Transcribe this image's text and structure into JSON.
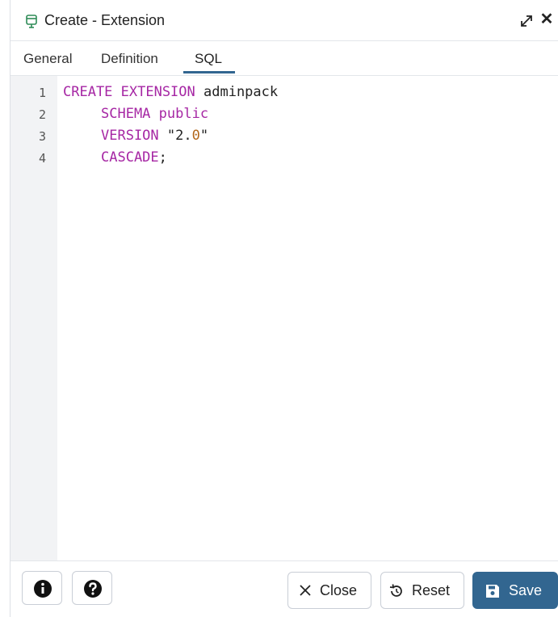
{
  "dialog": {
    "title": "Create - Extension"
  },
  "tabs": [
    {
      "label": "General"
    },
    {
      "label": "Definition"
    },
    {
      "label": "SQL"
    }
  ],
  "active_tab": "SQL",
  "editor": {
    "line_numbers": [
      "1",
      "2",
      "3",
      "4"
    ],
    "lines": [
      {
        "kw": "CREATE EXTENSION",
        "rest": " adminpack"
      },
      {
        "kw": "SCHEMA public",
        "rest": ""
      },
      {
        "kw": "VERSION",
        "str_open": " \"2.",
        "num": "0",
        "str_close": "\""
      },
      {
        "kw": "CASCADE",
        "rest": ";"
      }
    ]
  },
  "footer": {
    "info_icon": "info-icon",
    "help_icon": "help-icon",
    "close_label": "Close",
    "reset_label": "Reset",
    "save_label": "Save"
  },
  "colors": {
    "accent": "#326690",
    "keyword": "#a627a4",
    "number": "#b3681c"
  }
}
